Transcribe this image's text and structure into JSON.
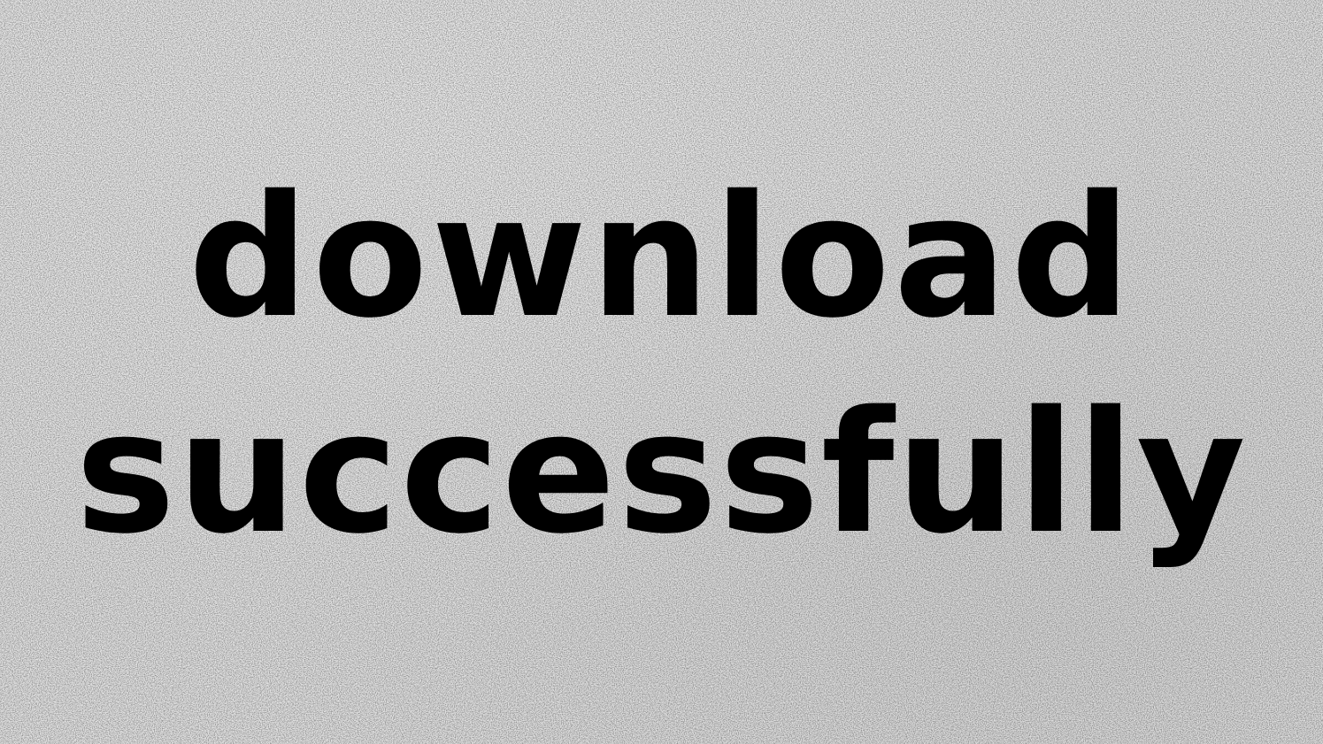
{
  "headline": {
    "line1": "download",
    "line2": "successfully"
  },
  "colors": {
    "background": "#e4e4e4",
    "text": "#000000"
  }
}
